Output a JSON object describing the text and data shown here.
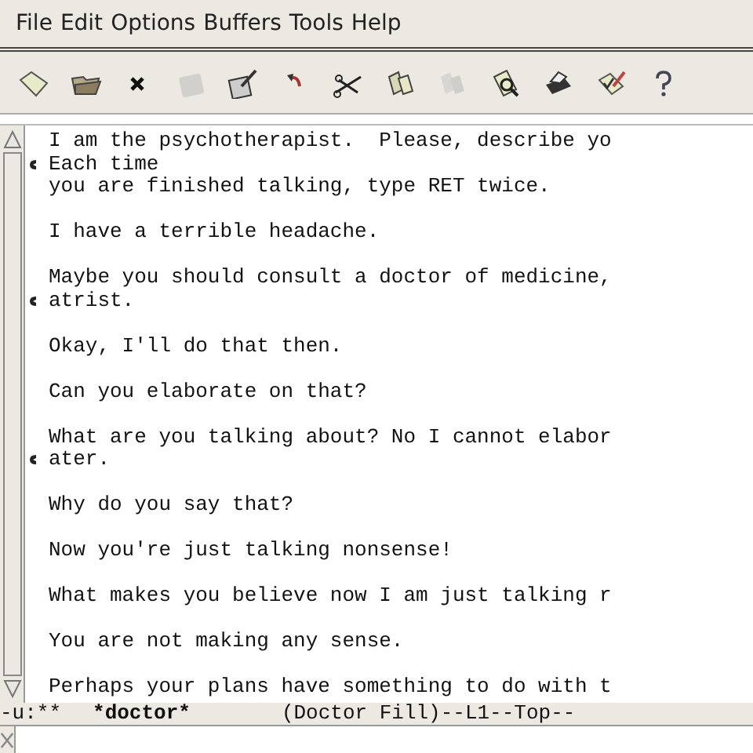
{
  "menu": [
    "File",
    "Edit",
    "Options",
    "Buffers",
    "Tools",
    "Help"
  ],
  "toolbar": [
    {
      "kind": "new",
      "disabled": false
    },
    {
      "kind": "open",
      "disabled": false
    },
    {
      "kind": "close",
      "disabled": false
    },
    {
      "kind": "save",
      "disabled": true
    },
    {
      "kind": "saveas",
      "disabled": false
    },
    {
      "kind": "undo",
      "disabled": false
    },
    {
      "kind": "cut",
      "disabled": false
    },
    {
      "kind": "copy",
      "disabled": false
    },
    {
      "kind": "paste",
      "disabled": true
    },
    {
      "kind": "search",
      "disabled": false
    },
    {
      "kind": "print",
      "disabled": false
    },
    {
      "kind": "customize",
      "disabled": false
    },
    {
      "kind": "help",
      "disabled": false
    }
  ],
  "buffer_lines": [
    {
      "kind": "text",
      "text": "I am the psychotherapist.  Please, describe yo"
    },
    {
      "kind": "continued",
      "text": "Each time"
    },
    {
      "kind": "text",
      "text": "you are finished talking, type RET twice."
    },
    {
      "kind": "blank"
    },
    {
      "kind": "text",
      "text": "I have a terrible headache."
    },
    {
      "kind": "blank"
    },
    {
      "kind": "text",
      "text": "Maybe you should consult a doctor of medicine,"
    },
    {
      "kind": "continued",
      "text": "atrist."
    },
    {
      "kind": "blank"
    },
    {
      "kind": "text",
      "text": "Okay, I'll do that then."
    },
    {
      "kind": "blank"
    },
    {
      "kind": "text",
      "text": "Can you elaborate on that?"
    },
    {
      "kind": "blank"
    },
    {
      "kind": "text",
      "text": "What are you talking about? No I cannot elabor"
    },
    {
      "kind": "continued",
      "text": "ater."
    },
    {
      "kind": "blank"
    },
    {
      "kind": "text",
      "text": "Why do you say that?"
    },
    {
      "kind": "blank"
    },
    {
      "kind": "text",
      "text": "Now you're just talking nonsense!"
    },
    {
      "kind": "blank"
    },
    {
      "kind": "text",
      "text": "What makes you believe now I am just talking r"
    },
    {
      "kind": "blank"
    },
    {
      "kind": "text",
      "text": "You are not making any sense."
    },
    {
      "kind": "blank"
    },
    {
      "kind": "text",
      "text": "Perhaps your plans have something to do with t"
    }
  ],
  "mode_line": {
    "status": "-u:**",
    "buffer_name": "*doctor*",
    "modes": "(Doctor Fill)--L1--Top--"
  }
}
